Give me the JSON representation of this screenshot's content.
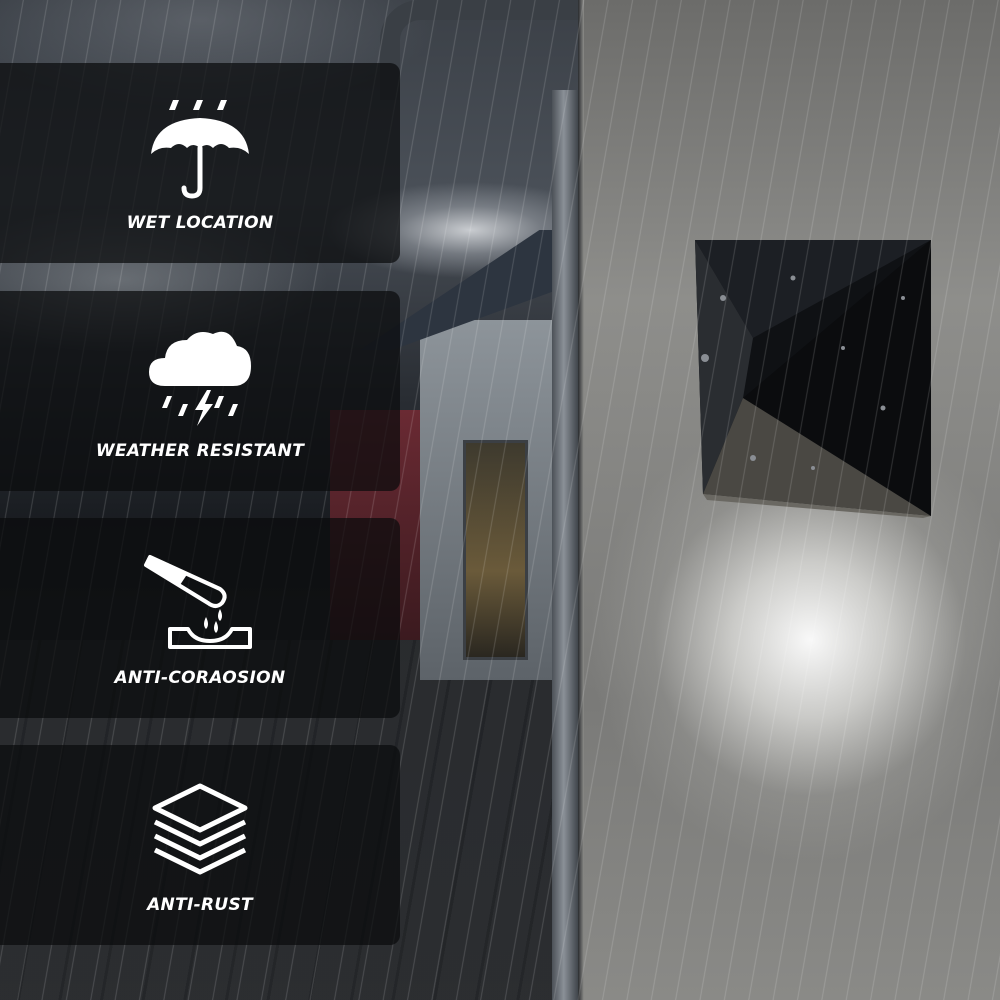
{
  "features": [
    {
      "label": "WET LOCATION",
      "icon": "umbrella-rain-icon"
    },
    {
      "label": "WEATHER RESISTANT",
      "icon": "storm-cloud-icon"
    },
    {
      "label": "ANTI-CORAOSION",
      "icon": "test-tube-drip-icon"
    },
    {
      "label": "ANTI-RUST",
      "icon": "stacked-layers-icon"
    }
  ],
  "colors": {
    "card_background": "#0a0b0d",
    "label_text": "#ffffff",
    "lamp_body": "#14161a",
    "wall": "#8e8e8b"
  }
}
